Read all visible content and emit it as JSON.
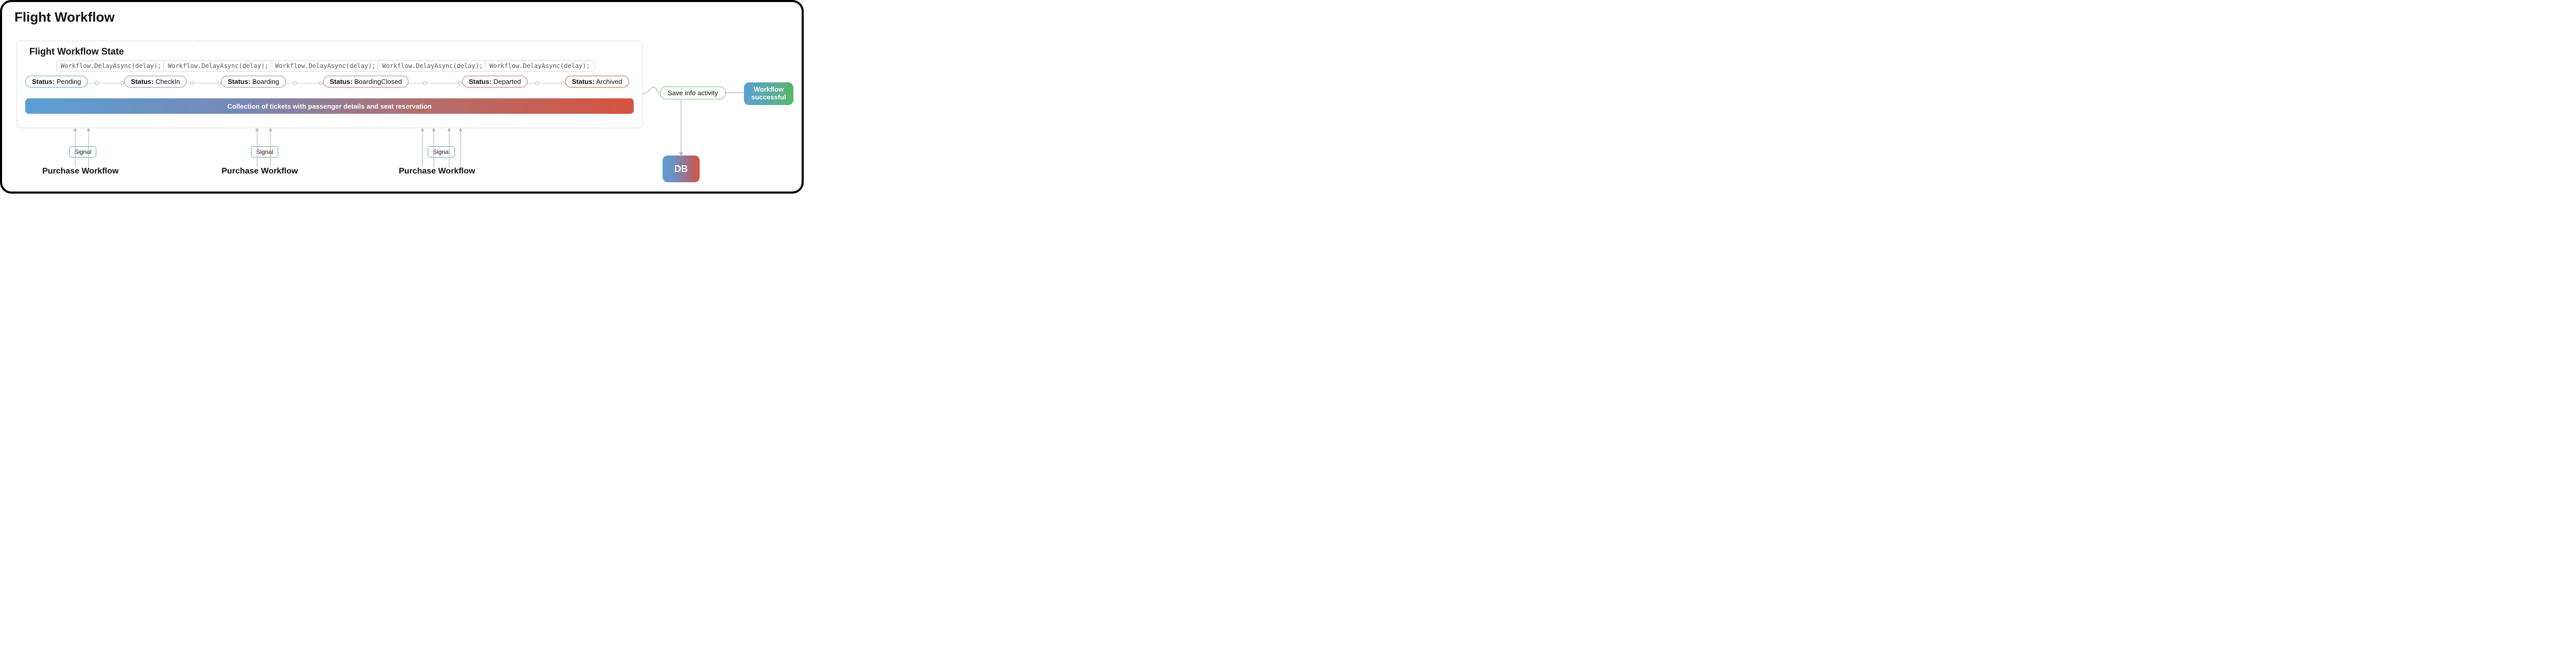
{
  "title": "Flight Workflow",
  "state": {
    "title": "Flight Workflow State",
    "delays": [
      "Workflow.DelayAsync(delay);",
      "Workflow.DelayAsync(delay);",
      "Workflow.DelayAsync(delay);",
      "Workflow.DelayAsync(delay);",
      "Workflow.DelayAsync(delay);"
    ],
    "statuses": [
      {
        "label": "Status:",
        "value": "Pending"
      },
      {
        "label": "Status:",
        "value": "CheckIn"
      },
      {
        "label": "Status:",
        "value": "Boarding"
      },
      {
        "label": "Status:",
        "value": "BoardingClosed"
      },
      {
        "label": "Status:",
        "value": "Departed"
      },
      {
        "label": "Status:",
        "value": "Archived"
      }
    ],
    "collection_bar": "Collection of tickets with passenger details and seat reservation"
  },
  "save_activity": "Save info activity",
  "workflow_success": "Workflow successful",
  "db": "DB",
  "signals": [
    {
      "label": "Signal",
      "caller": "Purchase Workflow"
    },
    {
      "label": "Signal",
      "caller": "Purchase Workflow"
    },
    {
      "label": "Signal",
      "caller": "Purchase Workflow"
    }
  ],
  "colors": {
    "gradient_blue": "#5a9fd4",
    "gradient_red": "#d4533f",
    "green": "#57b667"
  }
}
